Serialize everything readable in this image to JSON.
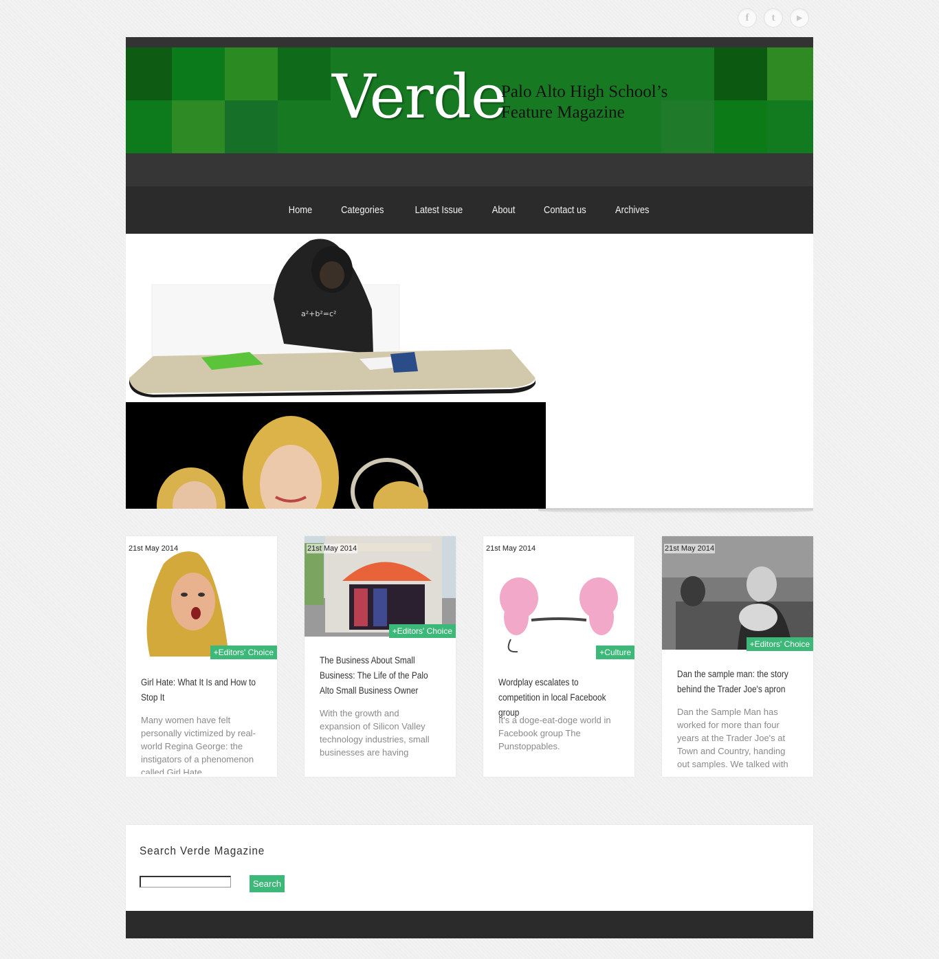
{
  "social": {
    "facebook": "f",
    "twitter": "t",
    "youtube": "▶"
  },
  "header": {
    "logo_title": "Verde",
    "subtitle_line1": "Palo Alto High School’s",
    "subtitle_line2": "Feature Magazine",
    "accent_color": "#177a22"
  },
  "nav": {
    "items": [
      "Home",
      "Categories",
      "Latest Issue",
      "About",
      "Contact us",
      "Archives"
    ]
  },
  "cards": [
    {
      "date": "21st May 2014",
      "tag": "+Editors' Choice",
      "title": "Girl Hate: What It Is and How to Stop It",
      "excerpt": "Many women have felt personally victimized by real-world Regina George: the instigators of a phenomenon called Girl Hate."
    },
    {
      "date": "21st May 2014",
      "tag": "+Editors' Choice",
      "title": "The Business About Small Business: The Life of the Palo Alto Small Business Owner",
      "excerpt": "With the growth and expansion of Silicon Valley technology industries, small businesses are having"
    },
    {
      "date": "21st May 2014",
      "tag": "+Culture",
      "title": "Wordplay escalates to competition in local Facebook group",
      "excerpt": "It's a doge-eat-doge world in Facebook group The Punstoppables."
    },
    {
      "date": "21st May 2014",
      "tag": "+Editors' Choice",
      "title": "Dan the sample man: the story behind the Trader Joe's apron",
      "excerpt": "Dan the Sample Man has worked for more than four years at the Trader Joe's at Town and Country, handing out samples. We talked with"
    }
  ],
  "search": {
    "heading": "Search Verde Magazine",
    "button_label": "Search",
    "placeholder": ""
  },
  "colors": {
    "tag_green": "#3cb878",
    "nav_bg": "#2b2b2b"
  }
}
